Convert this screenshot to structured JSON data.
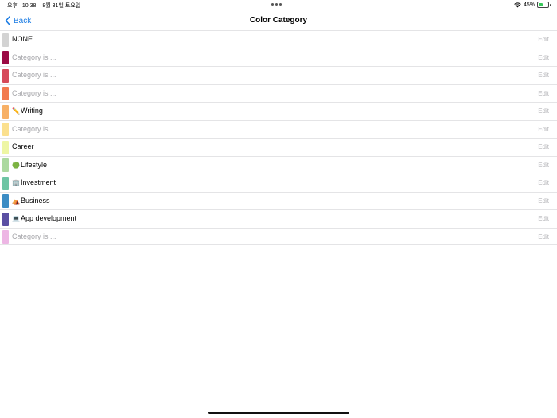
{
  "status_bar": {
    "ampm": "오후",
    "time": "10:38",
    "date": "8월 31일 토요일",
    "battery": "45%",
    "battery_level": 0.45
  },
  "nav": {
    "back_label": "Back",
    "title": "Color Category"
  },
  "edit_label": "Edit",
  "categories": [
    {
      "label": "NONE",
      "emoji": "",
      "color": "#d3d3d3",
      "placeholder": false
    },
    {
      "label": "Category is ...",
      "emoji": "",
      "color": "#9b0a44",
      "placeholder": true
    },
    {
      "label": "Category is ...",
      "emoji": "",
      "color": "#d64a5a",
      "placeholder": true
    },
    {
      "label": "Category is ...",
      "emoji": "",
      "color": "#f27a4f",
      "placeholder": true
    },
    {
      "label": "Writing",
      "emoji": "✏️",
      "color": "#f7b066",
      "placeholder": false
    },
    {
      "label": "Category is ...",
      "emoji": "",
      "color": "#fbe08e",
      "placeholder": true
    },
    {
      "label": "Career",
      "emoji": "",
      "color": "#eef6a4",
      "placeholder": false
    },
    {
      "label": "Lifestyle",
      "emoji": "🟢",
      "color": "#acd9a0",
      "placeholder": false
    },
    {
      "label": "Investment",
      "emoji": "🏢",
      "color": "#6ec5a4",
      "placeholder": false
    },
    {
      "label": "Business",
      "emoji": "⛺",
      "color": "#3b8cc4",
      "placeholder": false
    },
    {
      "label": "App development",
      "emoji": "💻",
      "color": "#5a4fa3",
      "placeholder": false
    },
    {
      "label": "Category is ...",
      "emoji": "",
      "color": "#edb6e4",
      "placeholder": true
    }
  ]
}
